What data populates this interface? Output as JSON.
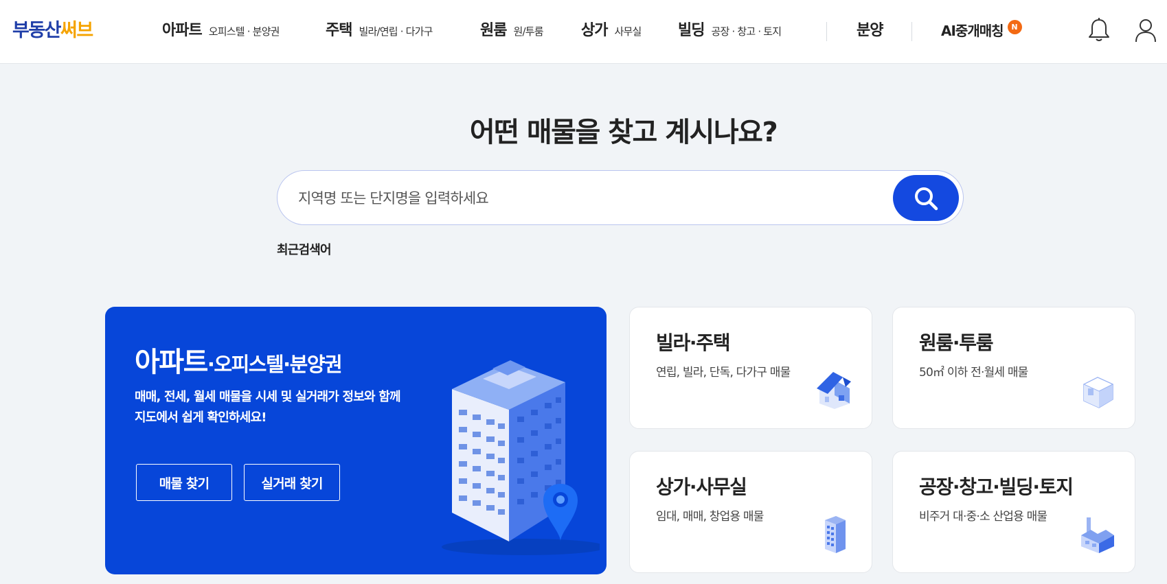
{
  "header": {
    "logo_part1": "부동산",
    "logo_part2": "써브",
    "nav": [
      {
        "label": "아파트",
        "sub": "오피스텔 · 분양권"
      },
      {
        "label": "주택",
        "sub": "빌라/연립 · 다가구"
      },
      {
        "label": "원룸",
        "sub": "원/투룸"
      },
      {
        "label": "상가",
        "sub": "사무실"
      },
      {
        "label": "빌딩",
        "sub": "공장 · 창고 · 토지"
      },
      {
        "label": "분양",
        "sub": ""
      }
    ],
    "ai_label": "AI중개매칭",
    "ai_badge": "N",
    "icons": [
      "bell-icon",
      "user-icon"
    ]
  },
  "hero": {
    "title_p1": "어떤 ",
    "title_b1": "매물",
    "title_p2": "을 ",
    "title_b2": "찾고",
    "title_p3": " 계시나요?",
    "search_placeholder": "지역명 또는 단지명을 입력하세요",
    "search_icon": "search-icon",
    "recent_label": "최근검색어"
  },
  "apt_card": {
    "title_big": "아파트",
    "title_small": "·오피스텔·분양권",
    "desc_line1": "매매, 전세, 월세 매물을 시세 및 실거래가 정보와 함께",
    "desc_line2": "지도에서 쉽게 확인하세요!",
    "btn_find": "매물 찾기",
    "btn_deal": "실거래 찾기",
    "illustration": "apartment-building-illustration"
  },
  "categories": [
    {
      "title": "빌라·주택",
      "desc": "연립, 빌라, 단독, 다가구 매물",
      "icon": "house-icon"
    },
    {
      "title": "원룸·투룸",
      "desc": "50㎡ 이하 전·월세 매물",
      "icon": "room-icon"
    },
    {
      "title": "상가·사무실",
      "desc": "임대, 매매, 창업용 매물",
      "icon": "office-building-icon"
    },
    {
      "title": "공장·창고·빌딩·토지",
      "desc": "비주거 대·중·소 산업용 매물",
      "icon": "factory-icon"
    }
  ],
  "colors": {
    "brand_blue": "#1f3ea8",
    "brand_yellow": "#f5a300",
    "primary": "#1449e0",
    "apt_card_bg": "#0746d9",
    "badge": "#f36a13"
  }
}
